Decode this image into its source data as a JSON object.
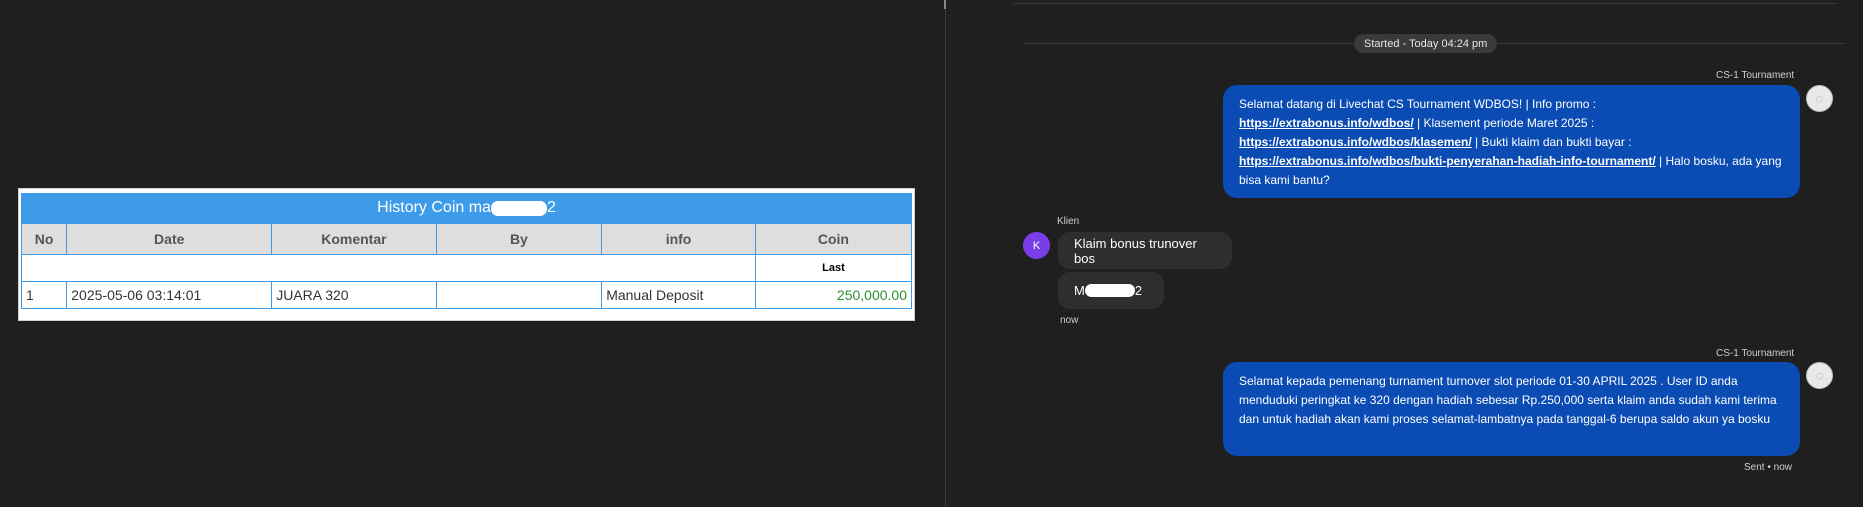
{
  "history": {
    "title_prefix": "History Coin ma",
    "title_suffix": "2",
    "columns": [
      "No",
      "Date",
      "Komentar",
      "By",
      "info",
      "Coin"
    ],
    "sub_header": "Last",
    "rows": [
      {
        "no": "1",
        "date": "2025-05-06 03:14:01",
        "komentar": "JUARA 320",
        "by": "",
        "info": "Manual Deposit",
        "coin": "250,000.00"
      }
    ]
  },
  "chat": {
    "started_label": "Started - Today 04:24 pm",
    "agent_name": "CS-1 Tournament",
    "client_name": "Klien",
    "client_initial": "K",
    "msg1": {
      "t1": "Selamat datang di Livechat CS Tournament WDBOS! | Info promo :",
      "link1": "https://extrabonus.info/wdbos/",
      "t2": " | Klasement periode Maret 2025 :",
      "link2": "https://extrabonus.info/wdbos/klasemen/",
      "t3": " | Bukti klaim dan bukti bayar :",
      "link3": "https://extrabonus.info/wdbos/bukti-penyerahan-hadiah-info-tournament/",
      "t4": " | Halo bosku, ada yang bisa kami bantu?"
    },
    "client_msg1": "Klaim bonus trunover bos",
    "client_msg2_prefix": "M",
    "client_msg2_suffix": "2",
    "client_time": "now",
    "msg2": "Selamat kepada pemenang turnament turnover slot periode 01-30 APRIL 2025 . User ID anda menduduki peringkat ke 320 dengan hadiah sebesar Rp.250,000 serta klaim anda sudah kami terima dan untuk hadiah akan kami proses selamat-lambatnya pada tanggal-6 berupa saldo akun ya bosku",
    "sent_status": "Sent • now"
  },
  "colors": {
    "table_header": "#3d9be9",
    "agent_bubble": "#0a4cb3",
    "client_bubble": "#2e2e30",
    "client_avatar": "#7a3ee8",
    "coin_value": "#2f8f2f"
  }
}
